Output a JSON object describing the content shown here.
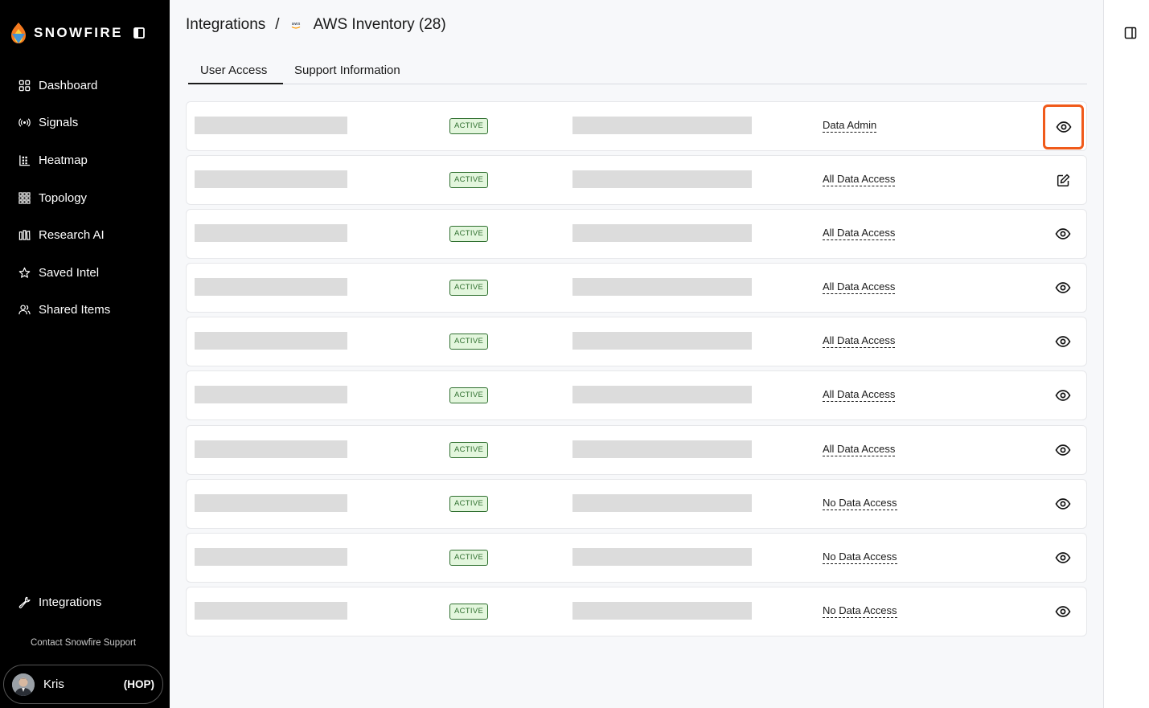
{
  "brand": {
    "name": "SNOWFIRE"
  },
  "nav": {
    "items": [
      {
        "label": "Dashboard",
        "icon": "dashboard-icon"
      },
      {
        "label": "Signals",
        "icon": "signals-icon"
      },
      {
        "label": "Heatmap",
        "icon": "heatmap-icon"
      },
      {
        "label": "Topology",
        "icon": "topology-icon"
      },
      {
        "label": "Research AI",
        "icon": "research-icon"
      },
      {
        "label": "Saved Intel",
        "icon": "star-icon"
      },
      {
        "label": "Shared Items",
        "icon": "users-icon"
      }
    ],
    "integrations": {
      "label": "Integrations",
      "icon": "wrench-icon"
    }
  },
  "support": {
    "label": "Contact Snowfire Support"
  },
  "user": {
    "name": "Kris",
    "org": "(HOP)"
  },
  "breadcrumb": {
    "root": "Integrations",
    "sep": "/",
    "current": "AWS Inventory (28)",
    "provider_icon": "aws-icon"
  },
  "tabs": [
    {
      "label": "User Access",
      "active": true
    },
    {
      "label": "Support Information",
      "active": false
    }
  ],
  "rows": [
    {
      "status": "ACTIVE",
      "role": "Data Admin",
      "action": "view",
      "highlighted": true
    },
    {
      "status": "ACTIVE",
      "role": "All Data Access",
      "action": "edit",
      "highlighted": false
    },
    {
      "status": "ACTIVE",
      "role": "All Data Access",
      "action": "view",
      "highlighted": false
    },
    {
      "status": "ACTIVE",
      "role": "All Data Access",
      "action": "view",
      "highlighted": false
    },
    {
      "status": "ACTIVE",
      "role": "All Data Access",
      "action": "view",
      "highlighted": false
    },
    {
      "status": "ACTIVE",
      "role": "All Data Access",
      "action": "view",
      "highlighted": false
    },
    {
      "status": "ACTIVE",
      "role": "All Data Access",
      "action": "view",
      "highlighted": false
    },
    {
      "status": "ACTIVE",
      "role": "No Data Access",
      "action": "view",
      "highlighted": false
    },
    {
      "status": "ACTIVE",
      "role": "No Data Access",
      "action": "view",
      "highlighted": false
    },
    {
      "status": "ACTIVE",
      "role": "No Data Access",
      "action": "view",
      "highlighted": false
    }
  ],
  "colors": {
    "highlight": "#f05a1a",
    "badge_bg": "#e3f6dd",
    "badge_fg": "#2f6f2f"
  }
}
